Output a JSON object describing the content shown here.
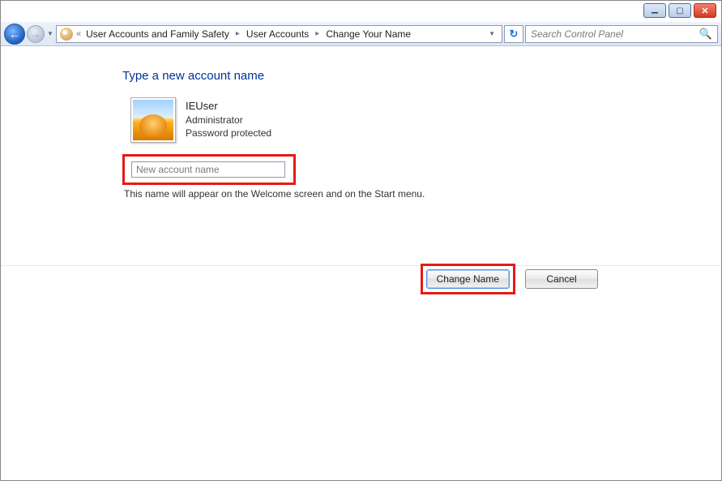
{
  "window": {
    "min_title": "Minimize",
    "max_title": "Maximize",
    "close_title": "Close"
  },
  "nav": {
    "chevrons": "«",
    "breadcrumb": [
      "User Accounts and Family Safety",
      "User Accounts",
      "Change Your Name"
    ],
    "search_placeholder": "Search Control Panel"
  },
  "page": {
    "title": "Type a new account name",
    "user": {
      "name": "IEUser",
      "role": "Administrator",
      "protection": "Password protected"
    },
    "input_placeholder": "New account name",
    "help": "This name will appear on the Welcome screen and on the Start menu."
  },
  "buttons": {
    "change": "Change Name",
    "cancel": "Cancel"
  },
  "highlight_color": "#e41b17"
}
